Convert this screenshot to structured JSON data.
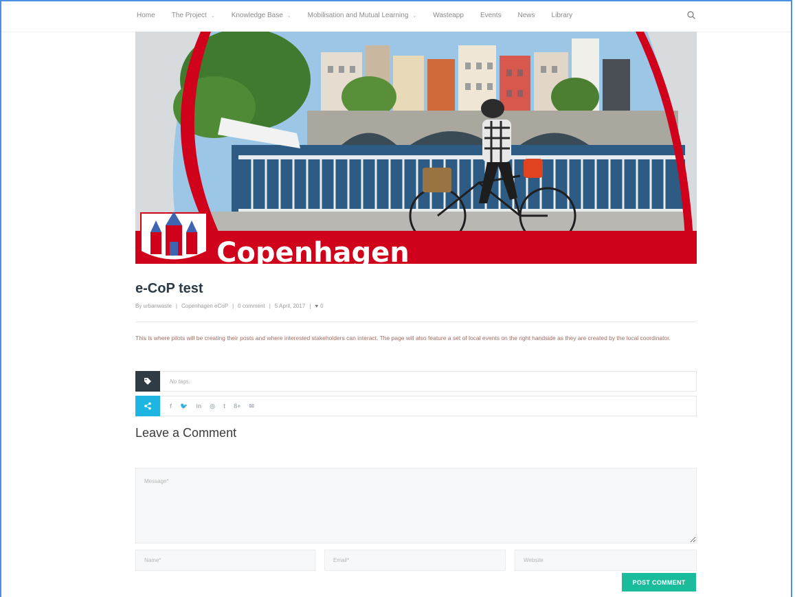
{
  "nav": {
    "items": [
      {
        "label": "Home",
        "dropdown": false
      },
      {
        "label": "The Project",
        "dropdown": true
      },
      {
        "label": "Knowledge Base",
        "dropdown": true
      },
      {
        "label": "Mobilisation and Mutual Learning",
        "dropdown": true
      },
      {
        "label": "Wasteapp",
        "dropdown": false
      },
      {
        "label": "Events",
        "dropdown": false
      },
      {
        "label": "News",
        "dropdown": false
      },
      {
        "label": "Library",
        "dropdown": false
      }
    ],
    "search_icon": "search-icon"
  },
  "hero": {
    "banner_text": "Copenhagen",
    "banner_color": "#d0021b"
  },
  "post": {
    "title": "e-CoP test",
    "meta": {
      "author": "By urbanwaste",
      "category": "Copenhagen eCoP",
      "comments": "0 comment",
      "date": "5 April, 2017",
      "likes": "0"
    },
    "excerpt": "This is where pilots will be creating their posts and where interested stakeholders can interact. The page will also feature a set of local events on the right handside as they are created by the local coordinator.",
    "tags_text": "No tags.",
    "share_icons": [
      "f",
      "🐦",
      "in",
      "◎",
      "t",
      "8+",
      "✉"
    ]
  },
  "comment_form": {
    "heading": "Leave a Comment",
    "message_placeholder": "Message*",
    "name_placeholder": "Name*",
    "email_placeholder": "Email*",
    "website_placeholder": "Website",
    "submit_label": "POST COMMENT"
  },
  "colors": {
    "accent_share": "#1fb5e2",
    "tag_box": "#2f3c46",
    "submit": "#1abc9c",
    "frame": "#4a8fe0"
  }
}
